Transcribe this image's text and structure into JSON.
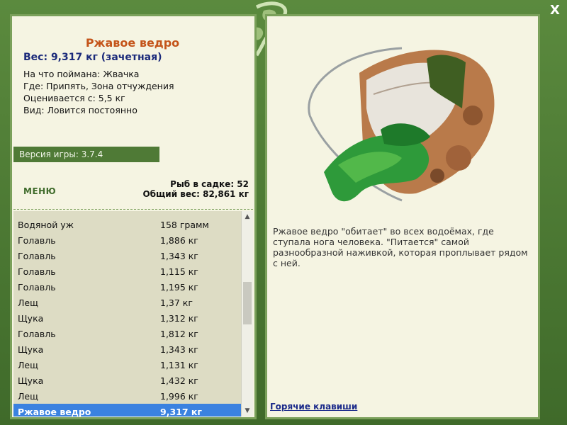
{
  "window": {
    "close_label": "X"
  },
  "fish": {
    "title": "Ржавое ведро",
    "weight": "Вес: 9,317 кг (зачетная)",
    "caught_on": "На что поймана: Жвачка",
    "where": "Где: Припять, Зона отчуждения",
    "valued_from": "Оценивается с: 5,5 кг",
    "kind": "Вид: Ловится постоянно"
  },
  "version": "Версия игры: 3.7.4",
  "menu_label": "МЕНЮ",
  "stats": {
    "fish_count": "Рыб в садке: 52",
    "total_weight": "Общий вес: 82,861 кг"
  },
  "catch_list": [
    {
      "name": "Водяной уж",
      "weight": "158 грамм"
    },
    {
      "name": "Голавль",
      "weight": "1,886 кг"
    },
    {
      "name": "Голавль",
      "weight": "1,343 кг"
    },
    {
      "name": "Голавль",
      "weight": "1,115 кг"
    },
    {
      "name": "Голавль",
      "weight": "1,195 кг"
    },
    {
      "name": "Лещ",
      "weight": "1,37 кг"
    },
    {
      "name": "Щука",
      "weight": "1,312 кг"
    },
    {
      "name": "Голавль",
      "weight": "1,812 кг"
    },
    {
      "name": "Щука",
      "weight": "1,343 кг"
    },
    {
      "name": "Лещ",
      "weight": "1,131 кг"
    },
    {
      "name": "Щука",
      "weight": "1,432 кг"
    },
    {
      "name": "Лещ",
      "weight": "1,996 кг"
    },
    {
      "name": "Ржавое ведро",
      "weight": "9,317 кг",
      "selected": true
    }
  ],
  "description": "Ржавое ведро \"обитает\" во всех водоёмах, где ступала нога человека. \"Питается\" самой разнообразной наживкой, которая проплывает рядом с ней.",
  "hotkeys_label": "Горячие клавиши",
  "colors": {
    "frame": "#4f7a36",
    "panel": "#f5f4e2",
    "title": "#c4541a",
    "weight": "#1b2a7a",
    "selected": "#3b82e0"
  }
}
